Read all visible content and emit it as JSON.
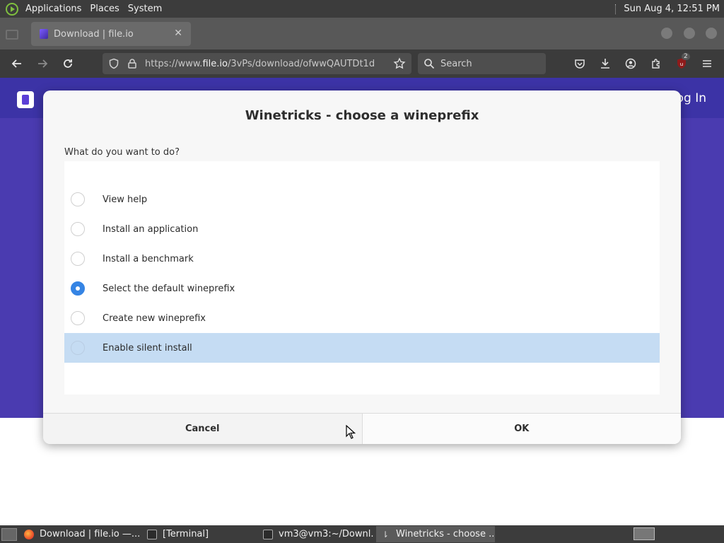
{
  "top_panel": {
    "menus": [
      "Applications",
      "Places",
      "System"
    ],
    "clock": "Sun Aug  4, 12:51 PM"
  },
  "browser": {
    "tab_title": "Download | file.io",
    "url_prefix": "https://www.",
    "url_host": "file.io",
    "url_path": "/3vPs/download/ofwwQAUTDt1d",
    "search_placeholder": "Search",
    "extension_badge": "2"
  },
  "page": {
    "login_label": "og In"
  },
  "dialog": {
    "title": "Winetricks - choose a wineprefix",
    "prompt": "What do you want to do?",
    "options": [
      {
        "label": "View help",
        "checked": false
      },
      {
        "label": "Install an application",
        "checked": false
      },
      {
        "label": "Install a benchmark",
        "checked": false
      },
      {
        "label": "Select the default wineprefix",
        "checked": true
      },
      {
        "label": "Create new wineprefix",
        "checked": false
      },
      {
        "label": "Enable silent install",
        "checked": false
      }
    ],
    "highlighted_option": 5,
    "cancel_label": "Cancel",
    "ok_label": "OK"
  },
  "taskbar": {
    "tasks": [
      {
        "label": "Download | file.io —...",
        "icon": "firefox-icon"
      },
      {
        "label": "[Terminal]",
        "icon": "terminal-icon"
      },
      {
        "label": "vm3@vm3:~/Downl...",
        "icon": "terminal-icon"
      },
      {
        "label": "Winetricks - choose ...",
        "icon": "wine-icon"
      }
    ],
    "active_task": 3
  },
  "colors": {
    "accent": "#3584e4",
    "highlight": "#c5dcf3",
    "page_purple": "#4a3bb0"
  }
}
